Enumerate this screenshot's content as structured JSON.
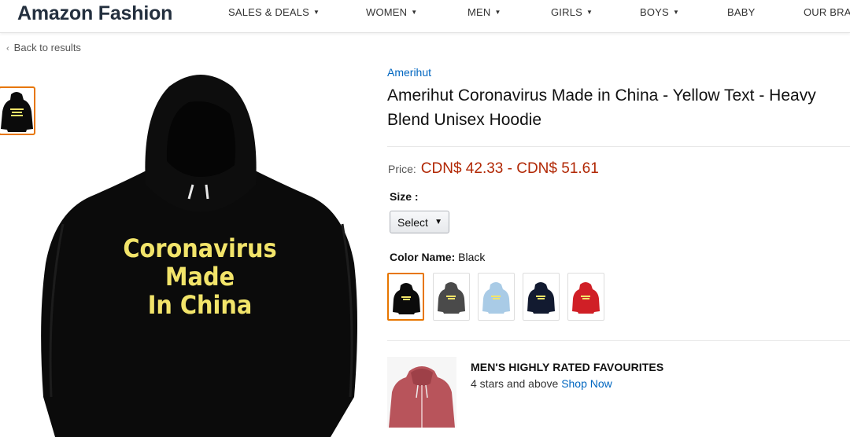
{
  "header": {
    "brand": "Amazon Fashion",
    "nav": [
      {
        "label": "SALES & DEALS",
        "dropdown": true
      },
      {
        "label": "WOMEN",
        "dropdown": true
      },
      {
        "label": "MEN",
        "dropdown": true
      },
      {
        "label": "GIRLS",
        "dropdown": true
      },
      {
        "label": "BOYS",
        "dropdown": true
      },
      {
        "label": "BABY",
        "dropdown": false
      },
      {
        "label": "OUR BRA",
        "dropdown": false
      }
    ]
  },
  "back_link": "Back to results",
  "product_image": {
    "print_lines": [
      "Coronavirus",
      "Made",
      "In China"
    ],
    "garment_color": "#0b0b0b",
    "print_color": "#f2e46a"
  },
  "product": {
    "brand": "Amerihut",
    "title": "Amerihut Coronavirus Made in China - Yellow Text - Heavy Blend Unisex Hoodie",
    "price_label": "Price:",
    "price": "CDN$ 42.33 - CDN$ 51.61",
    "size_label": "Size :",
    "size_select": "Select",
    "color_label": "Color Name:",
    "color_value": "Black",
    "swatches": [
      {
        "name": "Black",
        "color": "#0b0b0b",
        "selected": true
      },
      {
        "name": "Charcoal",
        "color": "#4a4a4a",
        "selected": false
      },
      {
        "name": "Light Blue",
        "color": "#a9cbe6",
        "selected": false
      },
      {
        "name": "Navy",
        "color": "#121a30",
        "selected": false
      },
      {
        "name": "Red",
        "color": "#d01f26",
        "selected": false
      }
    ]
  },
  "promo": {
    "title": "MEN'S HIGHLY RATED FAVOURITES",
    "subtitle": "4 stars and above",
    "link": "Shop Now"
  },
  "colors": {
    "accent_orange": "#e77600",
    "link_blue": "#0066c0",
    "price_red": "#b12704"
  }
}
